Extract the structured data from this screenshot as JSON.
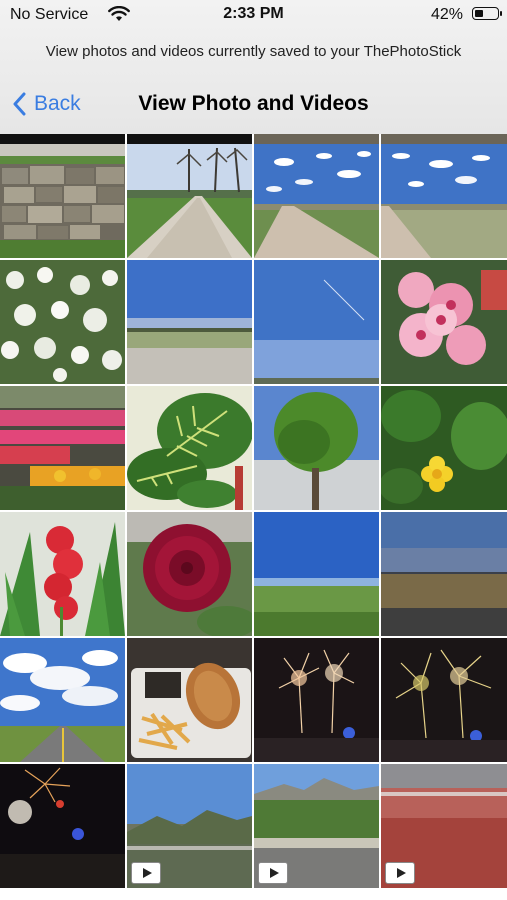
{
  "status_bar": {
    "carrier": "No Service",
    "time": "2:33 PM",
    "battery_percent": "42%",
    "battery_level": 0.42,
    "icons": [
      "wifi-icon",
      "battery-icon"
    ]
  },
  "header": {
    "subtitle": "View photos and videos currently saved to your ThePhotoStick",
    "back_label": "Back",
    "title": "View Photo and Videos"
  },
  "colors": {
    "accent": "#3a7de1",
    "header_bg": "#eeeeee"
  },
  "gallery": {
    "items": [
      {
        "subject": "stone wall",
        "type": "photo"
      },
      {
        "subject": "gravel path",
        "type": "photo"
      },
      {
        "subject": "dirt road",
        "type": "photo"
      },
      {
        "subject": "dirt road",
        "type": "photo"
      },
      {
        "subject": "blossoms",
        "type": "photo"
      },
      {
        "subject": "plain field",
        "type": "photo"
      },
      {
        "subject": "blue sky",
        "type": "photo"
      },
      {
        "subject": "pink geranium",
        "type": "photo"
      },
      {
        "subject": "flower beds",
        "type": "photo"
      },
      {
        "subject": "prayer plant",
        "type": "photo"
      },
      {
        "subject": "tree",
        "type": "photo"
      },
      {
        "subject": "yellow flower",
        "type": "photo"
      },
      {
        "subject": "red gladiolus",
        "type": "photo"
      },
      {
        "subject": "dahlia",
        "type": "photo"
      },
      {
        "subject": "green field",
        "type": "photo"
      },
      {
        "subject": "dusk field",
        "type": "photo"
      },
      {
        "subject": "highway clouds",
        "type": "photo"
      },
      {
        "subject": "fries and bread",
        "type": "photo"
      },
      {
        "subject": "fireworks",
        "type": "photo"
      },
      {
        "subject": "fireworks",
        "type": "photo"
      },
      {
        "subject": "night fireworks",
        "type": "photo"
      },
      {
        "subject": "mountains",
        "type": "video"
      },
      {
        "subject": "mountain road",
        "type": "video"
      },
      {
        "subject": "red car hood",
        "type": "video"
      }
    ]
  }
}
